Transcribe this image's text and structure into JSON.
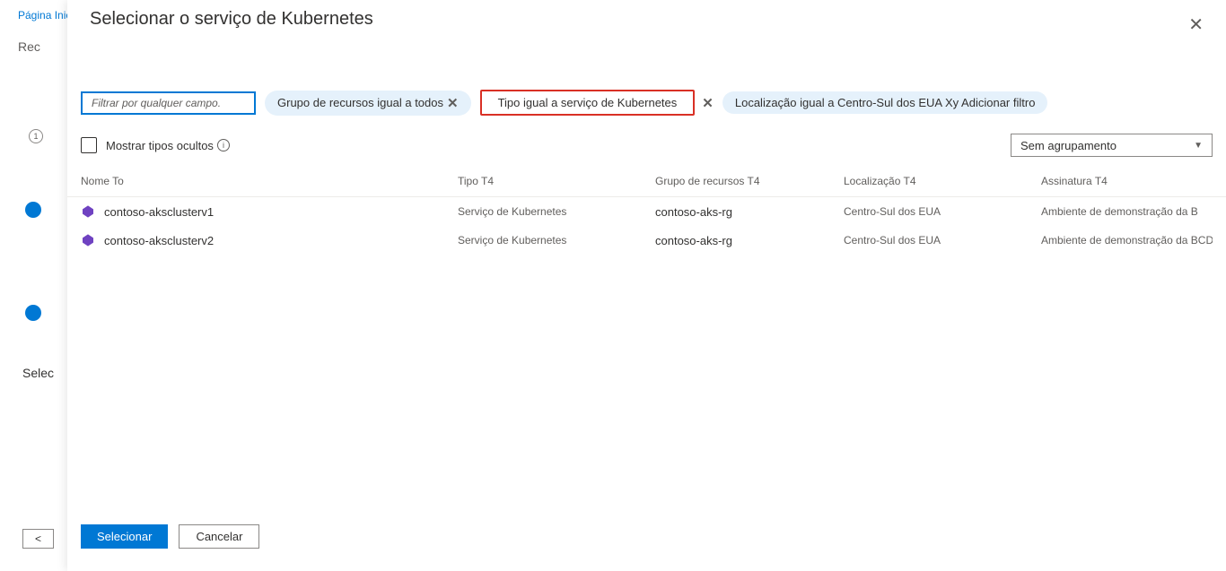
{
  "background": {
    "breadcrumb": "Página Inicial",
    "title": "Rec",
    "step_number": "1",
    "select_label": "Selec",
    "back_btn": "<"
  },
  "modal": {
    "title": "Selecionar o serviço de Kubernetes",
    "close_icon": "✕"
  },
  "filters": {
    "search_placeholder": "Filtrar por qualquer campo.",
    "pill_rg": "Grupo de recursos igual a todos",
    "pill_type": "Tipo igual a serviço de Kubernetes",
    "pill_location_add": "Localização igual a Centro-Sul dos EUA Xy Adicionar filtro"
  },
  "toolbar": {
    "show_hidden_label": "Mostrar tipos ocultos",
    "grouping_label": "Sem agrupamento"
  },
  "columns": {
    "name": "Nome To",
    "type": "Tipo T4",
    "rg": "Grupo de recursos T4",
    "loc": "Localização T4",
    "sub": "Assinatura T4"
  },
  "rows": [
    {
      "name": "contoso-aksclusterv1",
      "type": "Serviço de Kubernetes",
      "rg": "contoso-aks-rg",
      "loc": "Centro-Sul dos EUA",
      "sub": "Ambiente de demonstração da B"
    },
    {
      "name": "contoso-aksclusterv2",
      "type": "Serviço de Kubernetes",
      "rg": "contoso-aks-rg",
      "loc": "Centro-Sul dos EUA",
      "sub": "Ambiente de demonstração da BCDI"
    }
  ],
  "footer": {
    "select": "Selecionar",
    "cancel": "Cancelar"
  }
}
